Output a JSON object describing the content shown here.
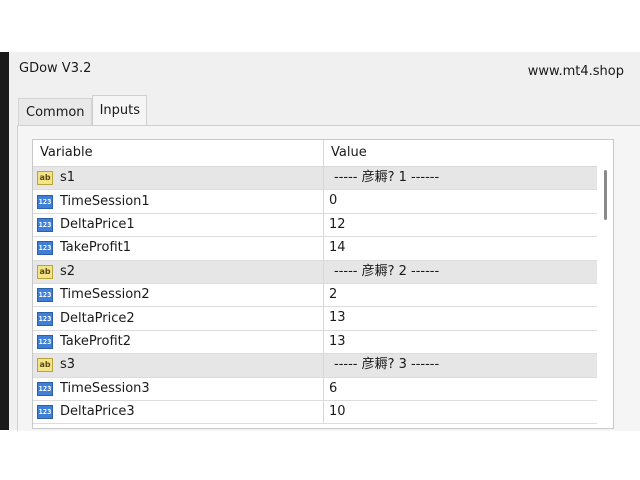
{
  "window": {
    "title": "GDow V3.2",
    "site": "www.mt4.shop"
  },
  "tabs": [
    {
      "label": "Common",
      "active": false
    },
    {
      "label": "Inputs",
      "active": true
    }
  ],
  "grid": {
    "columns": {
      "variable": "Variable",
      "value": "Value"
    },
    "rows": [
      {
        "type": "string",
        "icon": "ab",
        "name": "s1",
        "value": "----- 彦耨? 1 ------"
      },
      {
        "type": "number",
        "icon": "123",
        "name": "TimeSession1",
        "value": "0"
      },
      {
        "type": "number",
        "icon": "123",
        "name": "DeltaPrice1",
        "value": "12"
      },
      {
        "type": "number",
        "icon": "123",
        "name": "TakeProfit1",
        "value": "14"
      },
      {
        "type": "string",
        "icon": "ab",
        "name": "s2",
        "value": "----- 彦耨? 2 ------"
      },
      {
        "type": "number",
        "icon": "123",
        "name": "TimeSession2",
        "value": "2"
      },
      {
        "type": "number",
        "icon": "123",
        "name": "DeltaPrice2",
        "value": "13"
      },
      {
        "type": "number",
        "icon": "123",
        "name": "TakeProfit2",
        "value": "13"
      },
      {
        "type": "string",
        "icon": "ab",
        "name": "s3",
        "value": "----- 彦耨? 3 ------"
      },
      {
        "type": "number",
        "icon": "123",
        "name": "TimeSession3",
        "value": "6"
      },
      {
        "type": "number",
        "icon": "123",
        "name": "DeltaPrice3",
        "value": "10"
      }
    ]
  }
}
